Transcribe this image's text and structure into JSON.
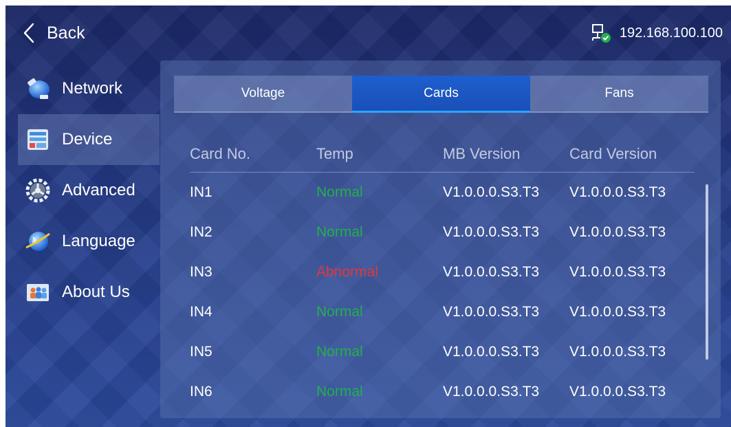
{
  "topbar": {
    "back_label": "Back",
    "ip_address": "192.168.100.100",
    "network_icon": "network-connected-icon"
  },
  "sidebar": {
    "items": [
      {
        "label": "Network",
        "icon": "network-icon"
      },
      {
        "label": "Device",
        "icon": "device-icon",
        "active": true
      },
      {
        "label": "Advanced",
        "icon": "advanced-gear-icon"
      },
      {
        "label": "Language",
        "icon": "language-globe-icon"
      },
      {
        "label": "About Us",
        "icon": "about-us-icon"
      }
    ]
  },
  "tabs": [
    {
      "label": "Voltage"
    },
    {
      "label": "Cards",
      "active": true
    },
    {
      "label": "Fans"
    }
  ],
  "table": {
    "headers": [
      "Card No.",
      "Temp",
      "MB Version",
      "Card Version"
    ],
    "rows": [
      {
        "card": "IN1",
        "temp": "Normal",
        "mb": "V1.0.0.0.S3.T3",
        "cv": "V1.0.0.0.S3.T3"
      },
      {
        "card": "IN2",
        "temp": "Normal",
        "mb": "V1.0.0.0.S3.T3",
        "cv": "V1.0.0.0.S3.T3"
      },
      {
        "card": "IN3",
        "temp": "Abnormal",
        "mb": "V1.0.0.0.S3.T3",
        "cv": "V1.0.0.0.S3.T3"
      },
      {
        "card": "IN4",
        "temp": "Normal",
        "mb": "V1.0.0.0.S3.T3",
        "cv": "V1.0.0.0.S3.T3"
      },
      {
        "card": "IN5",
        "temp": "Normal",
        "mb": "V1.0.0.0.S3.T3",
        "cv": "V1.0.0.0.S3.T3"
      },
      {
        "card": "IN6",
        "temp": "Normal",
        "mb": "V1.0.0.0.S3.T3",
        "cv": "V1.0.0.0.S3.T3"
      }
    ]
  },
  "colors": {
    "normal": "#22b04b",
    "abnormal": "#e0393c",
    "active_tab": "#1d5fcf",
    "tab_underline": "#2aa6ff"
  }
}
